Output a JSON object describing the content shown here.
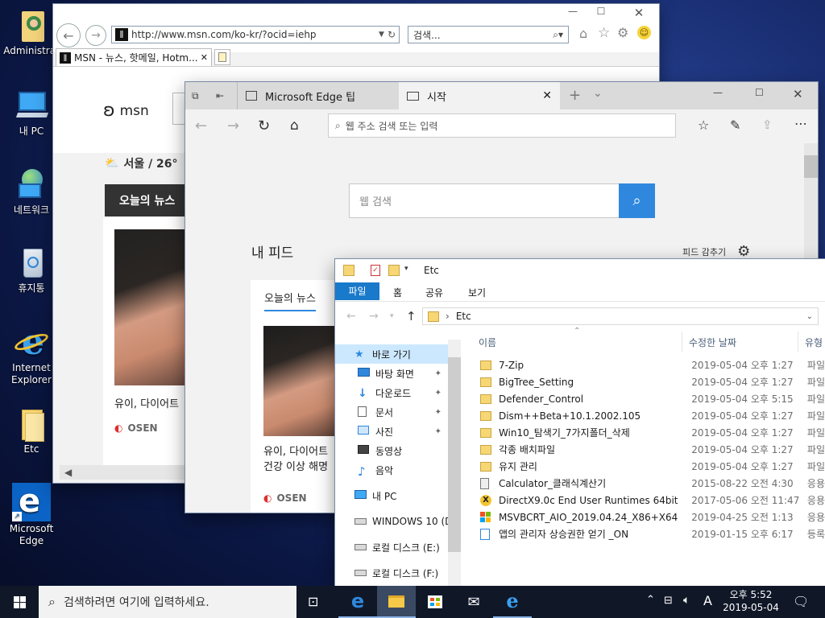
{
  "desktop": {
    "icons": [
      {
        "label": "Administrat",
        "icon": "user-folder-icon"
      },
      {
        "label": "내 PC",
        "icon": "computer-icon"
      },
      {
        "label": "네트워크",
        "icon": "network-icon"
      },
      {
        "label": "휴지통",
        "icon": "recycle-bin-icon"
      },
      {
        "label": "Internet Explorer",
        "icon": "ie-icon"
      },
      {
        "label": "Etc",
        "icon": "folder-icon"
      },
      {
        "label": "Microsoft Edge",
        "icon": "edge-icon"
      }
    ]
  },
  "ie": {
    "url": "http://www.msn.com/ko-kr/?ocid=iehp",
    "search_placeholder": "검색...",
    "tab_title": "MSN - 뉴스, 핫메일, Hotm...",
    "logo": "msn",
    "weather": "서울 / 26°",
    "news_tab": "오늘의 뉴스",
    "headline": "유이, 다이어트",
    "source": "OSEN"
  },
  "edge": {
    "tabs": [
      "Microsoft Edge 팁",
      "시작"
    ],
    "address_placeholder": "웹 주소 검색 또는 입력",
    "search_placeholder": "웹 검색",
    "feed_title": "내 피드",
    "feed_settings": "피드 감추기",
    "news_tab": "오늘의 뉴스",
    "headline_line1": "유이, 다이어트",
    "headline_line2": "건강 이상 해명",
    "source": "OSEN"
  },
  "explorer": {
    "title": "Etc",
    "ribbon": [
      "파일",
      "홈",
      "공유",
      "보기"
    ],
    "breadcrumb": "Etc",
    "columns": {
      "name": "이름",
      "modified": "수정한 날짜",
      "type": "유형"
    },
    "nav": [
      {
        "label": "바로 가기",
        "icon": "star-icon",
        "indent": 0,
        "pinned": false
      },
      {
        "label": "바탕 화면",
        "icon": "desktop-icon",
        "indent": 1,
        "pinned": true
      },
      {
        "label": "다운로드",
        "icon": "download-icon",
        "indent": 1,
        "pinned": true
      },
      {
        "label": "문서",
        "icon": "document-icon",
        "indent": 1,
        "pinned": true
      },
      {
        "label": "사진",
        "icon": "pictures-icon",
        "indent": 1,
        "pinned": true
      },
      {
        "label": "동영상",
        "icon": "video-icon",
        "indent": 1,
        "pinned": false
      },
      {
        "label": "음악",
        "icon": "music-icon",
        "indent": 1,
        "pinned": false
      },
      {
        "label": "내 PC",
        "icon": "computer-icon",
        "indent": 0,
        "pinned": false
      },
      {
        "label": "WINDOWS 10 (D",
        "icon": "drive-icon",
        "indent": 0,
        "pinned": false
      },
      {
        "label": "로컬 디스크 (E:)",
        "icon": "drive-icon",
        "indent": 0,
        "pinned": false
      },
      {
        "label": "로컬 디스크 (F:)",
        "icon": "drive-icon",
        "indent": 0,
        "pinned": false
      }
    ],
    "files": [
      {
        "name": "7-Zip",
        "date": "2019-05-04 오후 1:27",
        "type": "파일",
        "icon": "folder-icon"
      },
      {
        "name": "BigTree_Setting",
        "date": "2019-05-04 오후 1:27",
        "type": "파일",
        "icon": "folder-icon"
      },
      {
        "name": "Defender_Control",
        "date": "2019-05-04 오후 5:15",
        "type": "파일",
        "icon": "folder-icon"
      },
      {
        "name": "Dism++Beta+10.1.2002.105",
        "date": "2019-05-04 오후 1:27",
        "type": "파일",
        "icon": "folder-icon"
      },
      {
        "name": "Win10_탐색기_7가지폴더_삭제",
        "date": "2019-05-04 오후 1:27",
        "type": "파일",
        "icon": "folder-icon"
      },
      {
        "name": "각종 배치파일",
        "date": "2019-05-04 오후 1:27",
        "type": "파일",
        "icon": "folder-icon"
      },
      {
        "name": "유지 관리",
        "date": "2019-05-04 오후 1:27",
        "type": "파일",
        "icon": "folder-icon"
      },
      {
        "name": "Calculator_클래식계산기",
        "date": "2015-08-22 오전 4:30",
        "type": "응용",
        "icon": "calculator-icon"
      },
      {
        "name": "DirectX9.0c End User Runtimes 64bit",
        "date": "2017-05-06 오전 11:47",
        "type": "응용",
        "icon": "directx-icon"
      },
      {
        "name": "MSVBCRT_AIO_2019.04.24_X86+X64",
        "date": "2019-04-25 오전 1:13",
        "type": "응용",
        "icon": "msvbcrt-icon"
      },
      {
        "name": "앱의 관리자 상승권한 얻기 _ON",
        "date": "2019-01-15 오후 6:17",
        "type": "등록",
        "icon": "registry-icon"
      }
    ]
  },
  "taskbar": {
    "search_placeholder": "검색하려면 여기에 입력하세요.",
    "time": "오후 5:52",
    "date": "2019-05-04",
    "ime": "A"
  }
}
